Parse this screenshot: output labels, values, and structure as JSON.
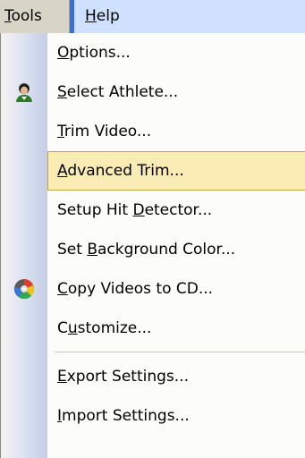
{
  "menubar": {
    "tools": {
      "pre": "",
      "key": "T",
      "post": "ools"
    },
    "help": {
      "pre": "",
      "key": "H",
      "post": "elp"
    }
  },
  "items": [
    {
      "pre": "",
      "key": "O",
      "post": "ptions...",
      "icon": null
    },
    {
      "pre": "",
      "key": "S",
      "post": "elect Athlete...",
      "icon": "athlete-icon"
    },
    {
      "pre": "",
      "key": "T",
      "post": "rim Video...",
      "icon": null
    },
    {
      "pre": "",
      "key": "A",
      "post": "dvanced Trim...",
      "icon": null,
      "selected": true
    },
    {
      "pre": "Setup Hit ",
      "key": "D",
      "post": "etector...",
      "icon": null
    },
    {
      "pre": "Set ",
      "key": "B",
      "post": "ackground Color...",
      "icon": null
    },
    {
      "pre": "",
      "key": "C",
      "post": "opy Videos to CD...",
      "icon": "cd-icon"
    },
    {
      "pre": "C",
      "key": "u",
      "post": "stomize...",
      "icon": null
    },
    {
      "pre": "",
      "key": "E",
      "post": "xport Settings...",
      "icon": null
    },
    {
      "pre": "",
      "key": "I",
      "post": "mport Settings...",
      "icon": null
    }
  ],
  "colors": {
    "menubar": "#ece9d8",
    "highlight": "#fbebb4",
    "highlight_border": "#c4a24c",
    "help_hover": "#d0e1ff"
  }
}
